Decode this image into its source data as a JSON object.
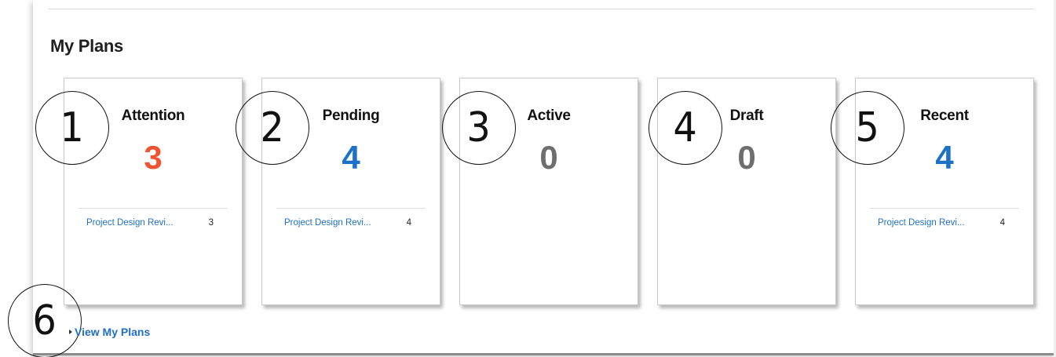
{
  "section": {
    "title": "My Plans"
  },
  "cards": [
    {
      "title": "Attention",
      "count": "3",
      "count_color": "#ef5533",
      "row": {
        "label": "Project Design Revi...",
        "count": "3"
      }
    },
    {
      "title": "Pending",
      "count": "4",
      "count_color": "#1b72c6",
      "row": {
        "label": "Project Design Revi...",
        "count": "4"
      }
    },
    {
      "title": "Active",
      "count": "0",
      "count_color": "#6e6e6e"
    },
    {
      "title": "Draft",
      "count": "0",
      "count_color": "#6e6e6e"
    },
    {
      "title": "Recent",
      "count": "4",
      "count_color": "#1b72c6",
      "row": {
        "label": "Project Design Revi...",
        "count": "4"
      }
    }
  ],
  "callouts": [
    "1",
    "2",
    "3",
    "4",
    "5",
    "6"
  ],
  "footer": {
    "link_label": "View My Plans",
    "caret_icon": "caret-right-icon"
  },
  "colors": {
    "link": "#1f6fc5",
    "attention": "#ef5533",
    "accent": "#1b72c6",
    "zero": "#6e6e6e"
  }
}
